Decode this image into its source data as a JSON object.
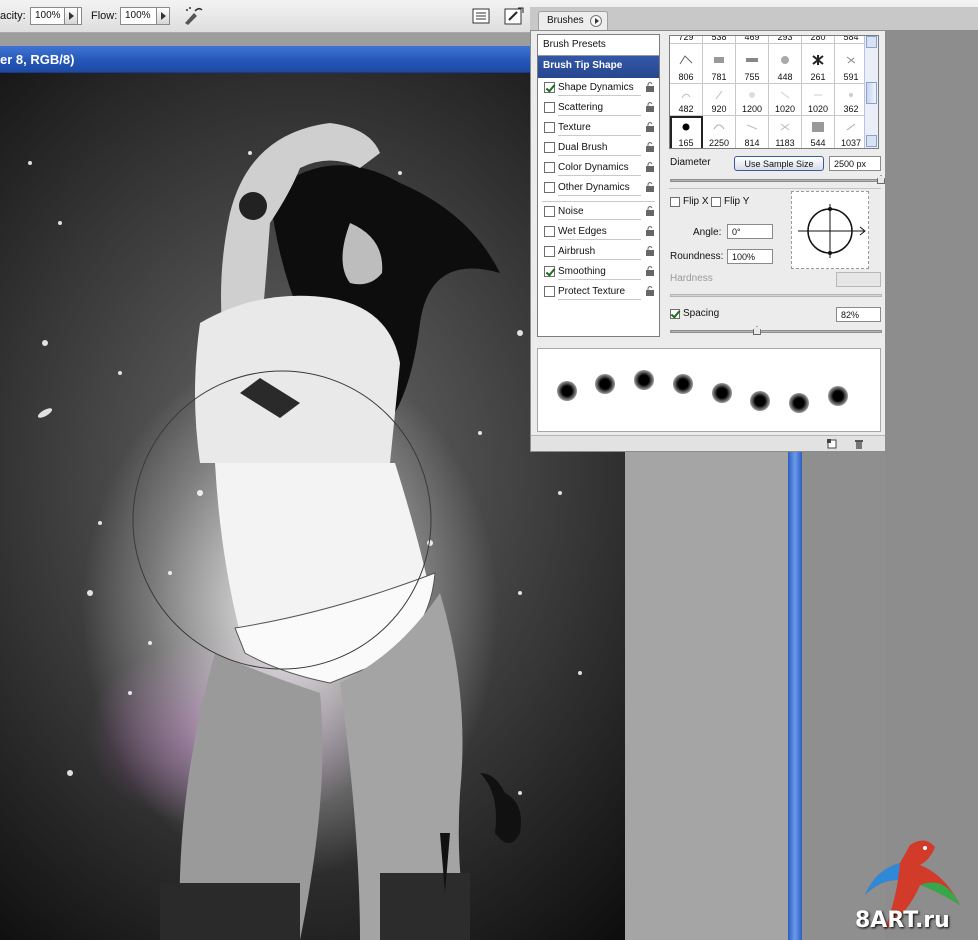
{
  "options_bar": {
    "opacity_label": "acity:",
    "opacity_value": "100%",
    "flow_label": "Flow:",
    "flow_value": "100%",
    "icons": [
      "airbrush-icon",
      "palette-toggle-icon",
      "brush-palette-icon"
    ]
  },
  "document": {
    "title": "er 8, RGB/8)"
  },
  "brushes": {
    "tab_label": "Brushes",
    "left_panel": {
      "presets": "Brush Presets",
      "tip_shape": "Brush Tip Shape",
      "options": [
        {
          "label": "Shape Dynamics",
          "checked": true
        },
        {
          "label": "Scattering",
          "checked": false
        },
        {
          "label": "Texture",
          "checked": false
        },
        {
          "label": "Dual Brush",
          "checked": false
        },
        {
          "label": "Color Dynamics",
          "checked": false
        },
        {
          "label": "Other Dynamics",
          "checked": false
        }
      ],
      "options2": [
        {
          "label": "Noise",
          "checked": false
        },
        {
          "label": "Wet Edges",
          "checked": false
        },
        {
          "label": "Airbrush",
          "checked": false
        },
        {
          "label": "Smoothing",
          "checked": true
        },
        {
          "label": "Protect Texture",
          "checked": false
        }
      ]
    },
    "tips": [
      [
        "729",
        "538",
        "469",
        "293",
        "280",
        "584"
      ],
      [
        "806",
        "781",
        "755",
        "448",
        "261",
        "591"
      ],
      [
        "482",
        "920",
        "1200",
        "1020",
        "1020",
        "362"
      ],
      [
        "165",
        "2250",
        "814",
        "1183",
        "544",
        "1037"
      ]
    ],
    "selected_tip": "165",
    "diameter_label": "Diameter",
    "use_sample_size": "Use Sample Size",
    "diameter_value": "2500 px",
    "flip_x": "Flip X",
    "flip_y": "Flip Y",
    "angle_label": "Angle:",
    "angle_value": "0°",
    "roundness_label": "Roundness:",
    "roundness_value": "100%",
    "hardness_label": "Hardness",
    "spacing_label": "Spacing",
    "spacing_checked": true,
    "spacing_value": "82%",
    "diameter_slider": 0.995,
    "spacing_slider": 0.41,
    "colors": {
      "tip_highlight": "#2b4d99",
      "frame_blue": "#2557b8"
    }
  },
  "watermark": {
    "text": "8ART.ru"
  }
}
